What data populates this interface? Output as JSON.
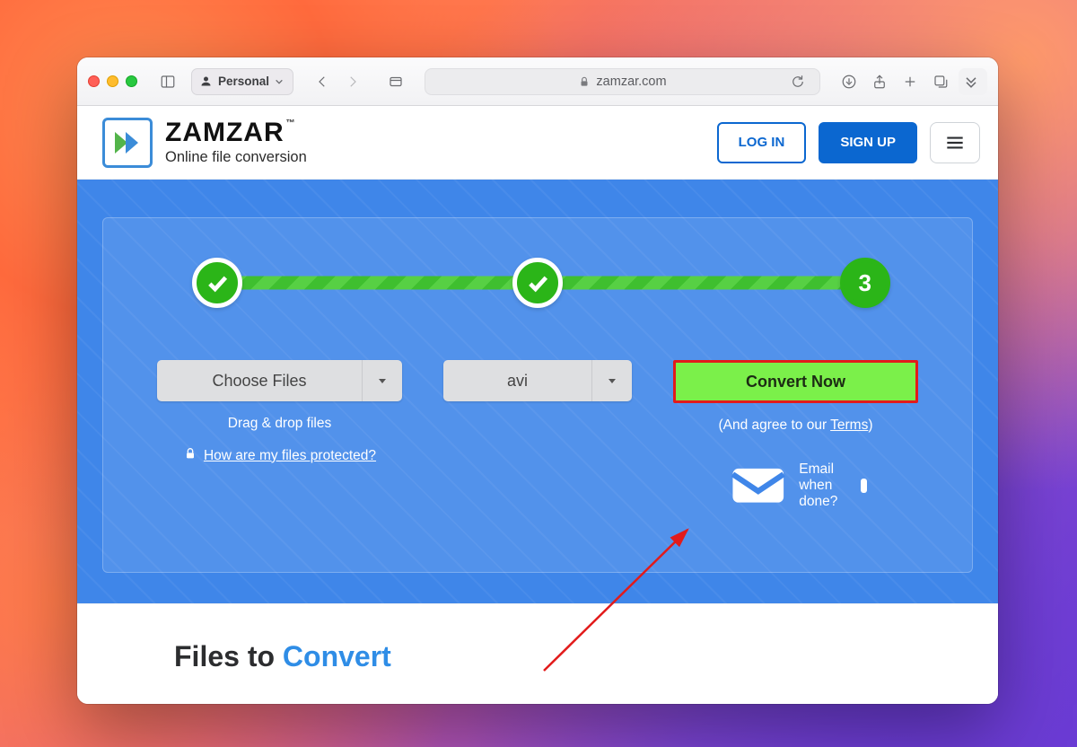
{
  "browser": {
    "profile_label": "Personal",
    "url_host": "zamzar.com"
  },
  "site": {
    "brand_title": "ZAMZAR",
    "brand_subtitle": "Online file conversion",
    "login_label": "LOG IN",
    "signup_label": "SIGN UP"
  },
  "stepper": {
    "step3_label": "3"
  },
  "actions": {
    "choose_files_label": "Choose Files",
    "drag_drop_label": "Drag & drop files",
    "protected_link": "How are my files protected?",
    "format_selected": "avi",
    "convert_label": "Convert Now",
    "agree_prefix": "(And agree to our ",
    "terms_label": "Terms",
    "agree_suffix": ")",
    "email_label": "Email when done?"
  },
  "lower": {
    "heading_a": "Files to ",
    "heading_b": "Convert"
  }
}
